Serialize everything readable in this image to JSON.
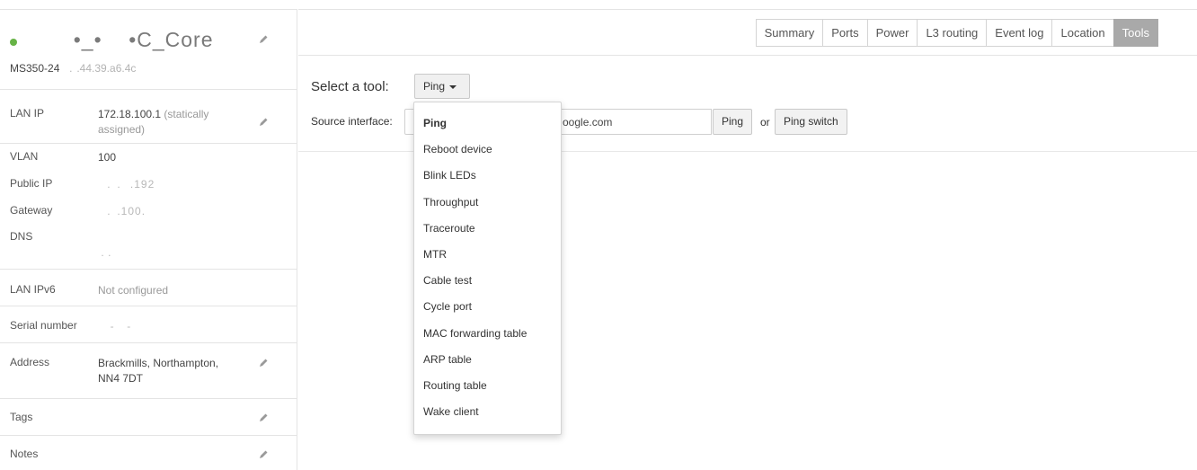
{
  "device": {
    "name": "•_—       C_Core",
    "name_display": "       •_•    •C_Core",
    "model": "MS350-24",
    "mac": "  .  .44.39.a6.4c",
    "status_color": "#67b346"
  },
  "details": {
    "lan_ip": {
      "label": "LAN IP",
      "value": "172.18.100.1",
      "note": "(statically",
      "note2": "assigned)"
    },
    "vlan": {
      "label": "VLAN",
      "value": "100"
    },
    "public_ip": {
      "label": "Public IP",
      "value": "   .  .   .192"
    },
    "gateway": {
      "label": "Gateway",
      "value": "   .  .100.   "
    },
    "dns": {
      "label": "DNS",
      "value1": "      ",
      "value2": " . .  "
    },
    "lan_ipv6": {
      "label": "LAN IPv6",
      "value": "Not configured"
    },
    "serial": {
      "label": "Serial number",
      "value": "    -    -    "
    },
    "address": {
      "label": "Address",
      "value": "Brackmills, Northampton,",
      "value2": "NN4 7DT"
    },
    "tags": {
      "label": "Tags"
    },
    "notes": {
      "label": "Notes"
    }
  },
  "tabs": [
    {
      "label": "Summary",
      "active": false
    },
    {
      "label": "Ports",
      "active": false
    },
    {
      "label": "Power",
      "active": false
    },
    {
      "label": "L3 routing",
      "active": false
    },
    {
      "label": "Event log",
      "active": false
    },
    {
      "label": "Location",
      "active": false
    },
    {
      "label": "Tools",
      "active": true
    }
  ],
  "tool": {
    "label": "Select a tool:",
    "selected": "Ping",
    "source_label": "Source interface:",
    "target_value": "oogle.com",
    "ping_button": "Ping",
    "or_text": "or",
    "ping_switch_button": "Ping switch"
  },
  "dropdown": {
    "items": [
      "Ping",
      "Reboot device",
      "Blink LEDs",
      "Throughput",
      "Traceroute",
      "MTR",
      "Cable test",
      "Cycle port",
      "MAC forwarding table",
      "ARP table",
      "Routing table",
      "Wake client"
    ]
  },
  "colors": {
    "active_tab_bg": "#a9a9a9",
    "border": "#e4e4e4"
  }
}
